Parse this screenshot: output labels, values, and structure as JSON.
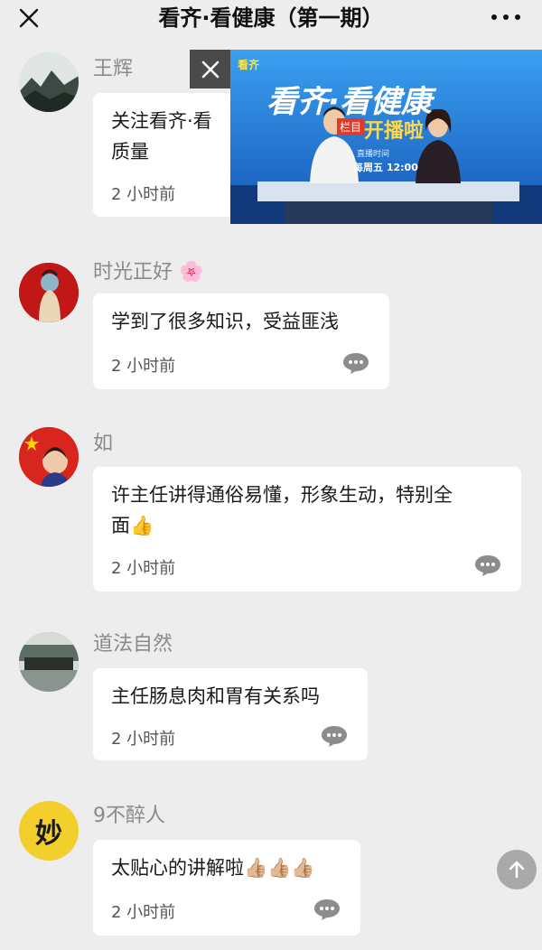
{
  "header": {
    "title": "看齐·看健康（第一期）"
  },
  "video": {
    "show_title": "看齐·看健康",
    "badge": "栏目",
    "subtitle": "开播啦",
    "schedule_label": "直播时间",
    "schedule": "每周五 12:00",
    "logo": "看齐"
  },
  "comments": [
    {
      "name": "王辉",
      "text_lines": [
        "关注看齐·看",
        "质量"
      ],
      "time": "2 小时前",
      "avatar_icon": "landscape-avatar"
    },
    {
      "name": "时光正好",
      "name_emoji": "🌸",
      "text_lines": [
        "学到了很多知识，受益匪浅"
      ],
      "time": "2 小时前",
      "avatar_icon": "girl-avatar"
    },
    {
      "name": "如",
      "text_lines": [
        "许主任讲得通俗易懂，形象生动，特别全",
        "面👍"
      ],
      "time": "2 小时前",
      "avatar_icon": "flag-avatar"
    },
    {
      "name": "道法自然",
      "text_lines": [
        "主任肠息肉和胃有关系吗"
      ],
      "time": "2 小时前",
      "avatar_icon": "gate-avatar"
    },
    {
      "name": "9不醉人",
      "text_lines": [
        "太贴心的讲解啦👍🏼👍🏼👍🏼"
      ],
      "time": "2 小时前",
      "avatar_icon": "calligraphy-avatar",
      "avatar_text": "妙"
    }
  ],
  "colors": {
    "background": "#ededed",
    "bubble": "#ffffff",
    "name": "#8a8a8a",
    "video_blue": "#1d6fd0"
  }
}
